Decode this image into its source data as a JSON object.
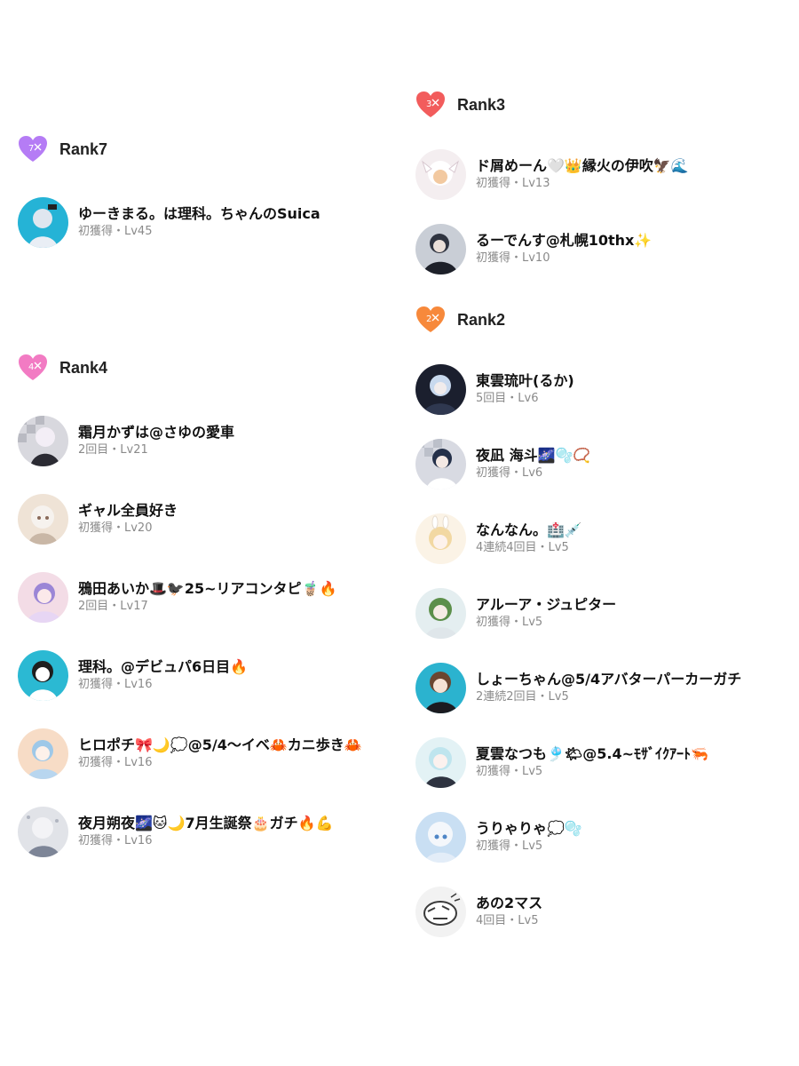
{
  "left_column": {
    "groups": [
      {
        "title": "Rank7",
        "badge_number": "7",
        "badge_color": "#b57cf5",
        "users": [
          {
            "name": "ゆーきまる。は理科。ちゃんのSuica",
            "meta": "初獲得・Lv45",
            "avatar_bg": "#25b3d6",
            "avatar_fg": "#dfe6ef"
          }
        ]
      },
      {
        "title": "Rank4",
        "badge_number": "4",
        "badge_color": "#f27bc3",
        "users": [
          {
            "name": "霜月かずは@さゆの愛車",
            "meta": "2回目・Lv21",
            "avatar_bg": "#d8d8de",
            "avatar_fg": "#f3eef6"
          },
          {
            "name": " ギャル全員好き",
            "meta": "初獲得・Lv20",
            "avatar_bg": "#efe3d6",
            "avatar_fg": "#f6f2ee"
          },
          {
            "name": "鴉田あいか🎩🐦‍⬛25~リアコンタピ🧋🔥",
            "meta": "2回目・Lv17",
            "avatar_bg": "#f3dce6",
            "avatar_fg": "#9b86d6"
          },
          {
            "name": "理科。@デビュパ6日目🔥",
            "meta": "初獲得・Lv16",
            "avatar_bg": "#2bb9d3",
            "avatar_fg": "#ffffff"
          },
          {
            "name": "ヒロポチ🎀🌙💭@5/4〜イベ🦀カニ歩き🦀",
            "meta": "初獲得・Lv16",
            "avatar_bg": "#f7dcc6",
            "avatar_fg": "#9ec8e8"
          },
          {
            "name": "夜月朔夜🌌🐱🌙7月生誕祭🎂ガチ🔥💪",
            "meta": "初獲得・Lv16",
            "avatar_bg": "#e1e3e8",
            "avatar_fg": "#7d8597"
          }
        ]
      }
    ]
  },
  "right_column": {
    "groups": [
      {
        "title": "Rank3",
        "badge_number": "3",
        "badge_color": "#f25c5c",
        "users": [
          {
            "name": "ド屑めーん🤍👑縁火の伊吹🦅🌊",
            "meta": "初獲得・Lv13",
            "avatar_bg": "#f4eef0",
            "avatar_fg": "#f2c9a0"
          },
          {
            "name": "るーでんす@札幌10thx✨",
            "meta": "初獲得・Lv10",
            "avatar_bg": "#c9ced6",
            "avatar_fg": "#2f3440"
          }
        ]
      },
      {
        "title": "Rank2",
        "badge_number": "2",
        "badge_color": "#f7893b",
        "users": [
          {
            "name": "東雲琉叶(るか)",
            "meta": "5回目・Lv6",
            "avatar_bg": "#1b1f2e",
            "avatar_fg": "#c8d9ee"
          },
          {
            "name": "夜凪 海斗🌌🫧📿",
            "meta": "初獲得・Lv6",
            "avatar_bg": "#d8dae2",
            "avatar_fg": "#243049"
          },
          {
            "name": "なんなん。🏥💉",
            "meta": "4連続4回目・Lv5",
            "avatar_bg": "#fbf3e6",
            "avatar_fg": "#f2d8a2"
          },
          {
            "name": "アルーア・ジュピター",
            "meta": "初獲得・Lv5",
            "avatar_bg": "#e4eef0",
            "avatar_fg": "#5c8f4a"
          },
          {
            "name": "しょーちゃん@5/4アバターパーカーガチ",
            "meta": "2連続2回目・Lv5",
            "avatar_bg": "#2bb3cf",
            "avatar_fg": "#6b4630"
          },
          {
            "name": "夏雲なつも🎐🌤@5.4~ﾓｻﾞｲｸｱｰﾄ🦐",
            "meta": "初獲得・Lv5",
            "avatar_bg": "#e3f2f5",
            "avatar_fg": "#bfe5ee"
          },
          {
            "name": "うりゃりゃ💭🫧",
            "meta": "初獲得・Lv5",
            "avatar_bg": "#c9dff3",
            "avatar_fg": "#f4f7fb"
          },
          {
            "name": "あの2マス",
            "meta": "4回目・Lv5",
            "avatar_bg": "#f2f2f2",
            "avatar_fg": "#3a3a3a"
          }
        ]
      }
    ]
  }
}
